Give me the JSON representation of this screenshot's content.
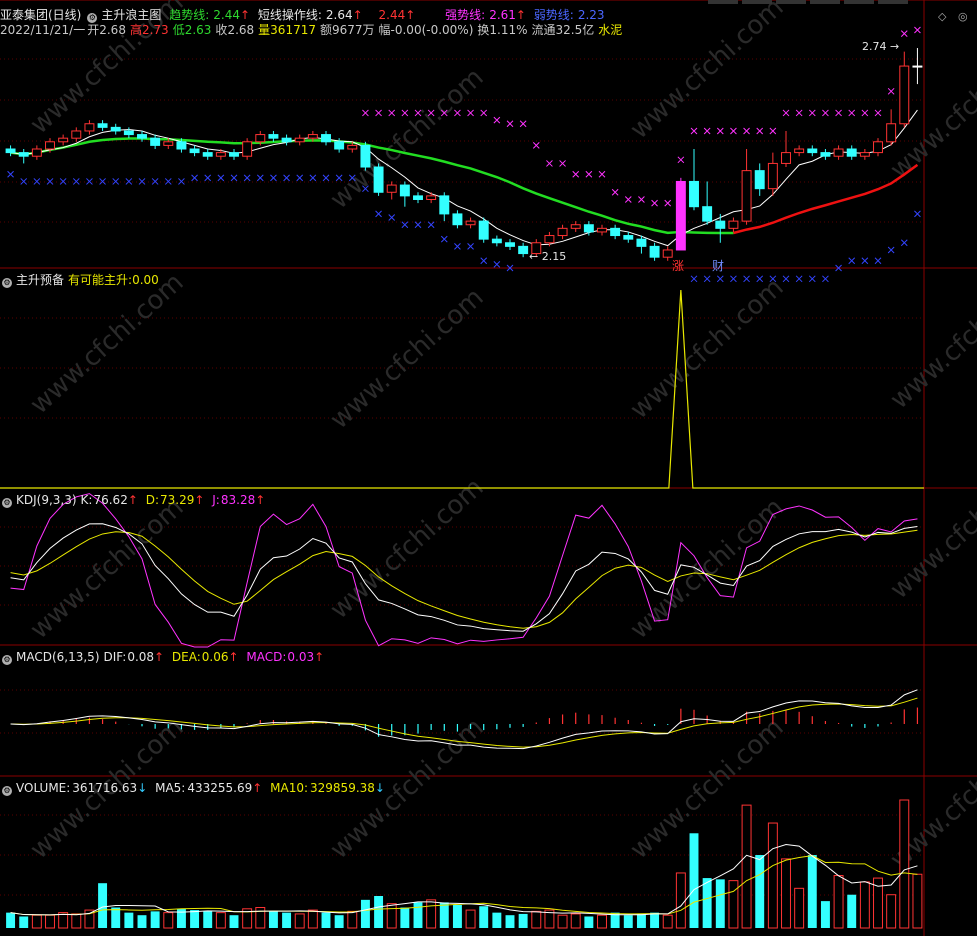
{
  "title_bar": {
    "stock": "亚泰集团(日线)",
    "indicator_name": "主升浪主图",
    "trend_label": "趋势线:",
    "trend_value": "2.44",
    "short_label": "短线操作线:",
    "short_value": "2.64",
    "red_value": "2.44",
    "strong_label": "强势线:",
    "strong_value": "2.61",
    "weak_label": "弱势线:",
    "weak_value": "2.23",
    "arrow_up": "↑",
    "arrow_down": "↓"
  },
  "quote_bar": {
    "date": "2022/11/21/一",
    "open_label": "开",
    "open": "2.68",
    "high_label": "高",
    "high": "2.73",
    "low_label": "低",
    "low": "2.63",
    "close_label": "收",
    "close": "2.68",
    "vol_label": "量",
    "vol": "361717",
    "amount": "额9677万",
    "change": "幅-0.00(-0.00%)",
    "turnover": "换1.11%",
    "float_cap": "流通32.5亿",
    "industry": "水泥"
  },
  "annotations": {
    "high_price": "2.74",
    "low_price": "2.15",
    "tag_zhang": "涨",
    "tag_cai": "财"
  },
  "panel_zhusheng": {
    "name": "主升预备",
    "label": "有可能主升:",
    "value": "0.00"
  },
  "panel_kdj": {
    "name": "KDJ(9,3,3)",
    "k_label": "K:",
    "k": "76.62",
    "d_label": "D:",
    "d": "73.29",
    "j_label": "J:",
    "j": "83.28"
  },
  "panel_macd": {
    "name": "MACD(6,13,5)",
    "dif_label": "DIF:",
    "dif": "0.08",
    "dea_label": "DEA:",
    "dea": "0.06",
    "macd_label": "MACD:",
    "macd": "0.03"
  },
  "panel_volume": {
    "name": "VOLUME:",
    "vol": "361716.63",
    "ma5_label": "MA5:",
    "ma5": "433255.69",
    "ma10_label": "MA10:",
    "ma10": "329859.38"
  },
  "watermark": "www.cfchi.com",
  "colors": {
    "up": "#ff3333",
    "down": "#33ffff",
    "green_line": "#22dd22",
    "red_line": "#ee1111",
    "magenta": "#ff33ff",
    "blue": "#3344ff",
    "yellow": "#e8e800",
    "grid": "#5a0000"
  },
  "chart_data": {
    "type": "candlestick",
    "price_range": [
      2.12,
      2.78
    ],
    "candles": [
      [
        2.45,
        2.44,
        2.46,
        2.43
      ],
      [
        2.44,
        2.43,
        2.45,
        2.41
      ],
      [
        2.43,
        2.45,
        2.46,
        2.42
      ],
      [
        2.45,
        2.47,
        2.48,
        2.44
      ],
      [
        2.47,
        2.48,
        2.49,
        2.46
      ],
      [
        2.48,
        2.5,
        2.51,
        2.47
      ],
      [
        2.5,
        2.52,
        2.53,
        2.49
      ],
      [
        2.52,
        2.51,
        2.53,
        2.5
      ],
      [
        2.51,
        2.5,
        2.52,
        2.49
      ],
      [
        2.5,
        2.49,
        2.51,
        2.48
      ],
      [
        2.49,
        2.48,
        2.5,
        2.47
      ],
      [
        2.48,
        2.46,
        2.49,
        2.45
      ],
      [
        2.46,
        2.47,
        2.48,
        2.45
      ],
      [
        2.47,
        2.45,
        2.48,
        2.44
      ],
      [
        2.45,
        2.44,
        2.46,
        2.43
      ],
      [
        2.44,
        2.43,
        2.45,
        2.42
      ],
      [
        2.43,
        2.44,
        2.45,
        2.42
      ],
      [
        2.44,
        2.43,
        2.45,
        2.42
      ],
      [
        2.43,
        2.47,
        2.48,
        2.42
      ],
      [
        2.47,
        2.49,
        2.5,
        2.46
      ],
      [
        2.49,
        2.48,
        2.5,
        2.47
      ],
      [
        2.48,
        2.47,
        2.49,
        2.46
      ],
      [
        2.47,
        2.48,
        2.49,
        2.46
      ],
      [
        2.48,
        2.49,
        2.5,
        2.47
      ],
      [
        2.49,
        2.47,
        2.5,
        2.46
      ],
      [
        2.47,
        2.45,
        2.48,
        2.44
      ],
      [
        2.45,
        2.46,
        2.47,
        2.44
      ],
      [
        2.46,
        2.4,
        2.47,
        2.39
      ],
      [
        2.4,
        2.33,
        2.41,
        2.32
      ],
      [
        2.33,
        2.35,
        2.36,
        2.31
      ],
      [
        2.35,
        2.32,
        2.36,
        2.29
      ],
      [
        2.32,
        2.31,
        2.33,
        2.3
      ],
      [
        2.31,
        2.32,
        2.33,
        2.3
      ],
      [
        2.32,
        2.27,
        2.33,
        2.25
      ],
      [
        2.27,
        2.24,
        2.28,
        2.23
      ],
      [
        2.24,
        2.25,
        2.26,
        2.23
      ],
      [
        2.25,
        2.2,
        2.26,
        2.19
      ],
      [
        2.2,
        2.19,
        2.21,
        2.18
      ],
      [
        2.19,
        2.18,
        2.2,
        2.17
      ],
      [
        2.18,
        2.16,
        2.19,
        2.15
      ],
      [
        2.16,
        2.19,
        2.2,
        2.15
      ],
      [
        2.19,
        2.21,
        2.22,
        2.18
      ],
      [
        2.21,
        2.23,
        2.24,
        2.2
      ],
      [
        2.23,
        2.24,
        2.25,
        2.22
      ],
      [
        2.24,
        2.22,
        2.25,
        2.21
      ],
      [
        2.22,
        2.23,
        2.24,
        2.21
      ],
      [
        2.23,
        2.21,
        2.24,
        2.2
      ],
      [
        2.21,
        2.2,
        2.22,
        2.19
      ],
      [
        2.2,
        2.18,
        2.21,
        2.16
      ],
      [
        2.18,
        2.15,
        2.19,
        2.14
      ],
      [
        2.15,
        2.17,
        2.18,
        2.14
      ],
      [
        2.17,
        2.36,
        2.37,
        2.17
      ],
      [
        2.36,
        2.29,
        2.45,
        2.28
      ],
      [
        2.29,
        2.25,
        2.36,
        2.24
      ],
      [
        2.25,
        2.23,
        2.27,
        2.19
      ],
      [
        2.23,
        2.25,
        2.26,
        2.22
      ],
      [
        2.25,
        2.39,
        2.45,
        2.24
      ],
      [
        2.39,
        2.34,
        2.41,
        2.32
      ],
      [
        2.34,
        2.41,
        2.44,
        2.32
      ],
      [
        2.41,
        2.44,
        2.5,
        2.4
      ],
      [
        2.44,
        2.45,
        2.46,
        2.43
      ],
      [
        2.45,
        2.44,
        2.46,
        2.43
      ],
      [
        2.44,
        2.43,
        2.45,
        2.42
      ],
      [
        2.43,
        2.45,
        2.46,
        2.42
      ],
      [
        2.45,
        2.43,
        2.46,
        2.42
      ],
      [
        2.43,
        2.44,
        2.45,
        2.42
      ],
      [
        2.44,
        2.47,
        2.48,
        2.43
      ],
      [
        2.47,
        2.52,
        2.56,
        2.46
      ],
      [
        2.52,
        2.68,
        2.72,
        2.51
      ],
      [
        2.68,
        2.68,
        2.73,
        2.63
      ]
    ],
    "volumes": [
      0.12,
      0.09,
      0.1,
      0.1,
      0.12,
      0.11,
      0.14,
      0.35,
      0.16,
      0.12,
      0.1,
      0.13,
      0.12,
      0.15,
      0.14,
      0.13,
      0.12,
      0.1,
      0.15,
      0.16,
      0.13,
      0.12,
      0.11,
      0.14,
      0.12,
      0.1,
      0.13,
      0.22,
      0.25,
      0.19,
      0.16,
      0.2,
      0.22,
      0.2,
      0.18,
      0.14,
      0.17,
      0.12,
      0.1,
      0.11,
      0.13,
      0.14,
      0.1,
      0.11,
      0.09,
      0.1,
      0.12,
      0.1,
      0.11,
      0.12,
      0.1,
      0.43,
      0.74,
      0.39,
      0.38,
      0.37,
      0.96,
      0.57,
      0.82,
      0.54,
      0.31,
      0.57,
      0.21,
      0.41,
      0.26,
      0.36,
      0.39,
      0.26,
      1.0,
      0.42
    ]
  }
}
